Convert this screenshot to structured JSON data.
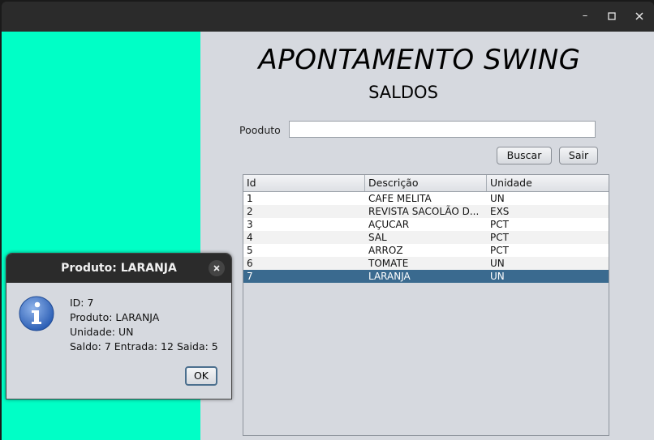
{
  "window": {
    "minimize_icon": "minimize-icon",
    "maximize_icon": "maximize-icon",
    "close_icon": "close-icon"
  },
  "colors": {
    "left_panel": "#00ffc6",
    "selection": "#3a6a8f",
    "content_bg": "#d6d9df"
  },
  "main": {
    "title": "APONTAMENTO SWING",
    "subtitle": "SALDOS",
    "product_label": "Pooduto",
    "product_value": "",
    "search_button": "Buscar",
    "exit_button": "Sair"
  },
  "table": {
    "columns": [
      "Id",
      "Descrição",
      "Unidade"
    ],
    "rows": [
      {
        "id": "1",
        "desc": "CAFE MELITA",
        "unit": "UN"
      },
      {
        "id": "2",
        "desc": "REVISTA SACOLÃO D...",
        "unit": "EXS"
      },
      {
        "id": "3",
        "desc": "AÇUCAR",
        "unit": "PCT"
      },
      {
        "id": "4",
        "desc": "SAL",
        "unit": "PCT"
      },
      {
        "id": "5",
        "desc": "ARROZ",
        "unit": "PCT"
      },
      {
        "id": "6",
        "desc": "TOMATE",
        "unit": "UN"
      },
      {
        "id": "7",
        "desc": "LARANJA",
        "unit": "UN"
      }
    ],
    "selected_row": "7"
  },
  "dialog": {
    "title": "Produto: LARANJA",
    "icon": "info-icon",
    "lines": [
      "ID: 7",
      "Produto: LARANJA",
      "Unidade: UN",
      "Saldo: 7 Entrada: 12 Saida: 5"
    ],
    "ok_button": "OK"
  }
}
